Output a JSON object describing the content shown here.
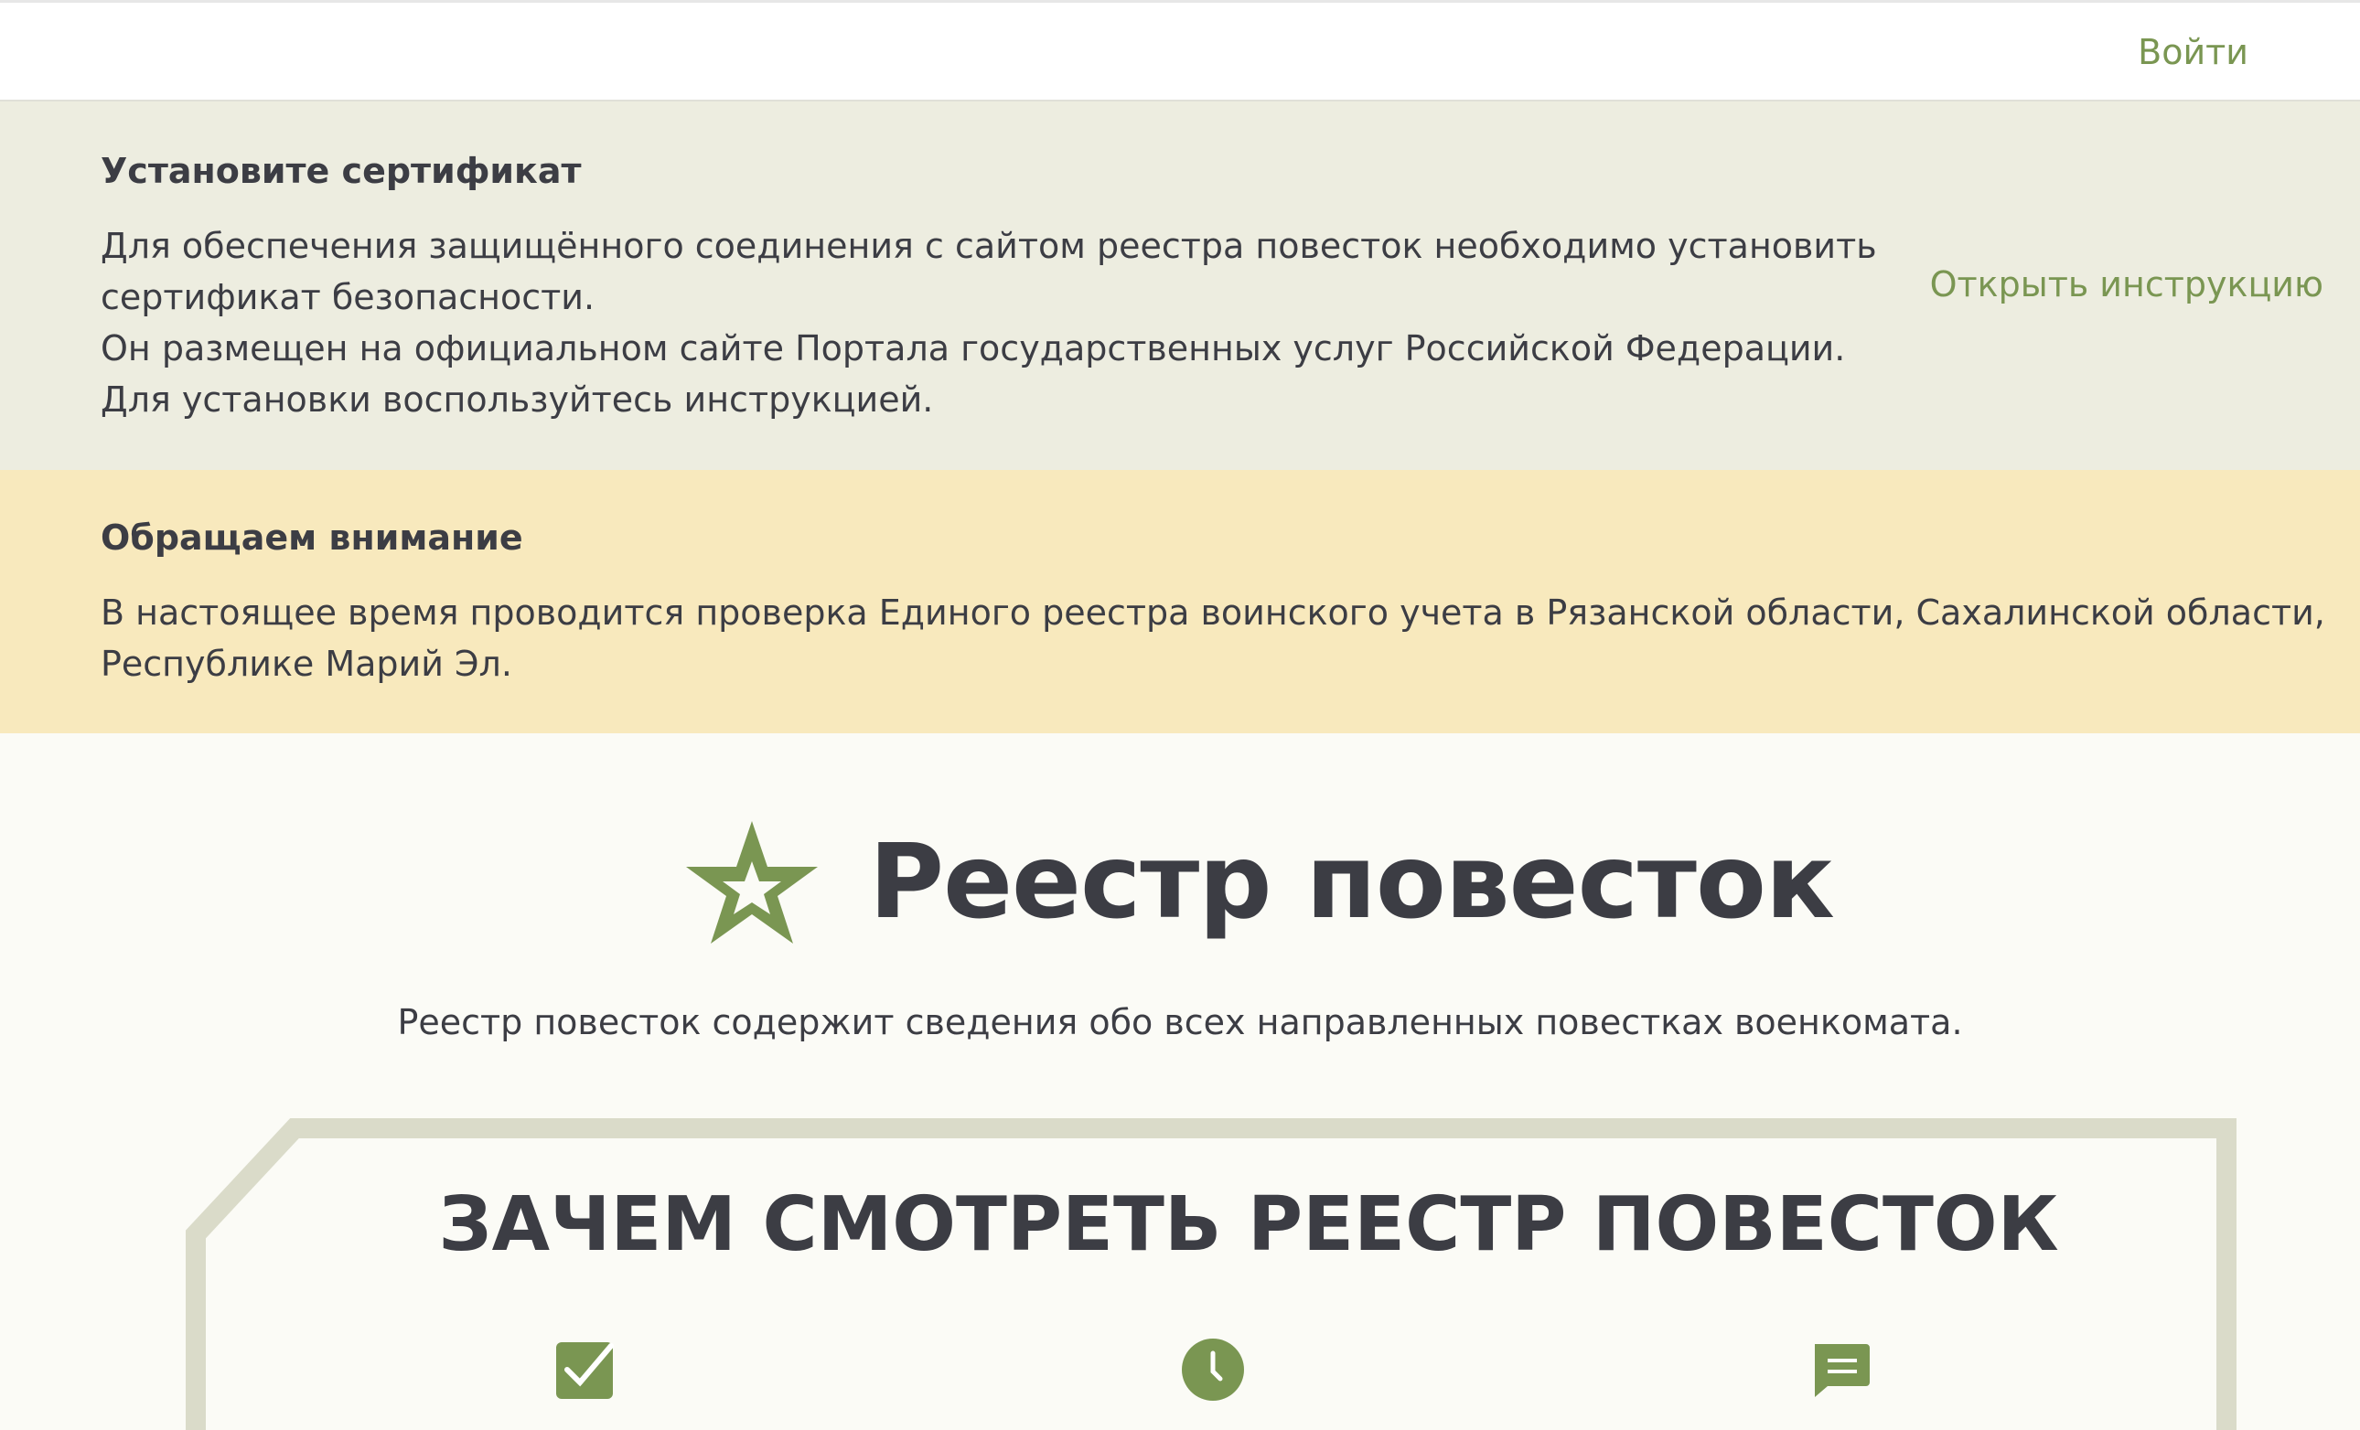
{
  "header": {
    "login_label": "Войти"
  },
  "cert_banner": {
    "title": "Установите сертификат",
    "lines": [
      "Для обеспечения защищённого соединения с сайтом реестра повесток необходимо установить",
      "сертификат безопасности.",
      "Он размещен на официальном сайте Портала государственных услуг Российской Федерации.",
      "Для установки воспользуйтесь инструкцией."
    ],
    "link_label": "Открыть инструкцию"
  },
  "attention_banner": {
    "title": "Обращаем внимание",
    "lines": [
      "В настоящее время проводится проверка Единого реестра воинского учета в Рязанской области, Сахалинской области,",
      "Республике Марий Эл."
    ]
  },
  "hero": {
    "title": "Реестр повесток",
    "subtitle": "Реестр повесток содержит сведения обо всех направленных повестках военкомата."
  },
  "why_section": {
    "title": "ЗАЧЕМ СМОТРЕТЬ РЕЕСТР ПОВЕСТОК",
    "icons": [
      "check-icon",
      "clock-icon",
      "message-icon"
    ]
  },
  "colors": {
    "accent_green": "#7a9652",
    "cert_bg": "#edede0",
    "attention_bg": "#f8e9bd",
    "page_bg": "#fbfbf6",
    "frame": "#dadbc9",
    "text": "#3c3d44"
  }
}
